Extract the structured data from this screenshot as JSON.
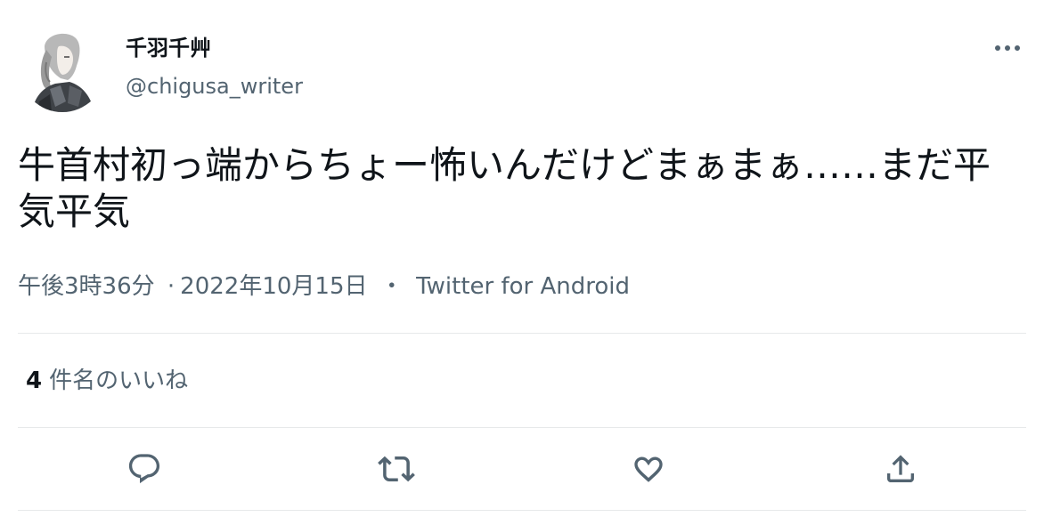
{
  "user": {
    "display_name": "千羽千艸",
    "handle": "@chigusa_writer",
    "avatar_icon": "user-avatar"
  },
  "tweet": {
    "text": "牛首村初っ端からちょー怖いんだけどまぁまぁ……まだ平気平気",
    "time": "午後3時36分",
    "date_separator": "·",
    "date": "2022年10月15日",
    "source_separator": "・",
    "source": "Twitter for Android"
  },
  "likes": {
    "count": "4",
    "label": "件名のいいね"
  },
  "actions": [
    {
      "icon": "reply-icon"
    },
    {
      "icon": "retweet-icon"
    },
    {
      "icon": "like-icon"
    },
    {
      "icon": "share-icon"
    }
  ],
  "more_icon": "more-icon",
  "colors": {
    "text_primary": "#0f1419",
    "text_secondary": "#536471",
    "divider": "#e7e9ea"
  }
}
